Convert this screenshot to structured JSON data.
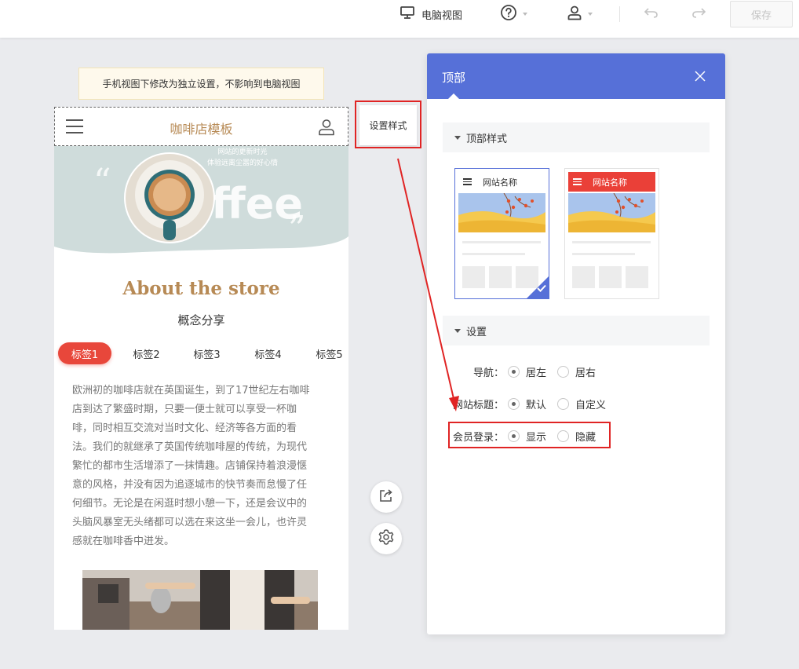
{
  "toolbar": {
    "pc_view_label": "电脑视图",
    "save_label": "保存"
  },
  "notice": "手机视图下修改为独立设置，不影响到电脑视图",
  "phone": {
    "site_title": "咖啡店模板",
    "hero_line1": "网站的更新时光",
    "hero_line2": "体验远离尘嚣的好心情",
    "hero_word": "Coffee",
    "about_title": "About the store",
    "concept": "概念分享",
    "tabs": [
      "标签1",
      "标签2",
      "标签3",
      "标签4",
      "标签5"
    ],
    "article": [
      "欧洲初的咖啡店就在英国诞生，到了17世纪左右咖啡",
      "店到达了繁盛时期，只要一便士就可以享受一杯咖",
      "啡，同时相互交流对当时文化、经济等各方面的看",
      "法。我们的就继承了英国传统咖啡屋的传统，为现代",
      "繁忙的都市生活增添了一抹情趣。店铺保持着浪漫惬",
      "意的风格，并没有因为追逐城市的快节奏而怠慢了任",
      "何细节。无论是在闲逛时想小憩一下，还是会议中的",
      "头脑风暴室无头绪都可以选在来这坐一会儿，也许灵",
      "感就在咖啡香中迸发。"
    ]
  },
  "style_button_label": "设置样式",
  "panel": {
    "title": "顶部",
    "section_style": "顶部样式",
    "cards": [
      {
        "name": "网站名称",
        "variant": "plain",
        "selected": true
      },
      {
        "name": "网站名称",
        "variant": "red",
        "selected": false
      }
    ],
    "section_settings": "设置",
    "options": [
      {
        "label": "导航：",
        "choices": [
          "居左",
          "居右"
        ],
        "selected": 0
      },
      {
        "label": "网站标题：",
        "choices": [
          "默认",
          "自定义"
        ],
        "selected": 0
      },
      {
        "label": "会员登录：",
        "choices": [
          "显示",
          "隐藏"
        ],
        "selected": 0
      }
    ]
  },
  "colors": {
    "accent_blue": "#5670d8",
    "tab_red": "#e8473b",
    "title_brown": "#b78a55",
    "annotation_red": "#e02424"
  }
}
